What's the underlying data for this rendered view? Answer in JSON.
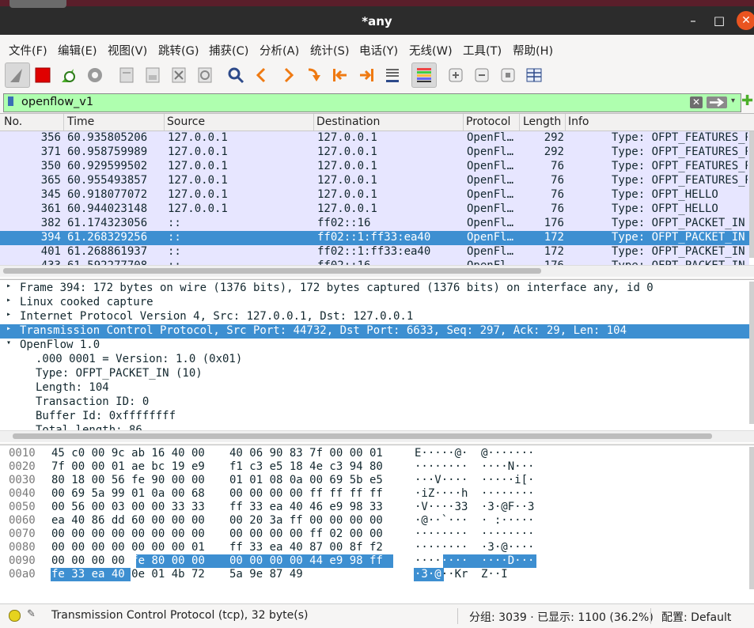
{
  "window": {
    "title": "*any",
    "minimize_label": "–",
    "maximize_label": "□",
    "close_label": "✕"
  },
  "menu": [
    "文件(F)",
    "编辑(E)",
    "视图(V)",
    "跳转(G)",
    "捕获(C)",
    "分析(A)",
    "统计(S)",
    "电话(Y)",
    "无线(W)",
    "工具(T)",
    "帮助(H)"
  ],
  "toolbar": {
    "icons": [
      "shark-fin-start-icon",
      "stop-capture-icon",
      "restart-capture-icon",
      "capture-options-icon",
      "open-file-icon",
      "save-file-icon",
      "close-file-icon",
      "reload-file-icon",
      "find-packet-icon",
      "go-back-icon",
      "go-forward-icon",
      "go-to-packet-icon",
      "go-first-icon",
      "go-last-icon",
      "autoscroll-icon",
      "colorize-icon",
      "zoom-in-icon",
      "zoom-out-icon",
      "normal-size-icon",
      "resize-columns-icon"
    ]
  },
  "filter": {
    "value": "openflow_v1",
    "clear_label": "✕"
  },
  "packet_list": {
    "columns": [
      "No.",
      "Time",
      "Source",
      "Destination",
      "Protocol",
      "Length",
      "Info"
    ],
    "rows": [
      {
        "no": "356",
        "time": "60.935805206",
        "src": "127.0.0.1",
        "dst": "127.0.0.1",
        "proto": "OpenFl…",
        "len": "292",
        "info": "Type: OFPT_FEATURES_REPLY"
      },
      {
        "no": "371",
        "time": "60.958759989",
        "src": "127.0.0.1",
        "dst": "127.0.0.1",
        "proto": "OpenFl…",
        "len": "292",
        "info": "Type: OFPT_FEATURES_REPLY"
      },
      {
        "no": "350",
        "time": "60.929599502",
        "src": "127.0.0.1",
        "dst": "127.0.0.1",
        "proto": "OpenFl…",
        "len": "76",
        "info": "Type: OFPT_FEATURES_REQUEST"
      },
      {
        "no": "365",
        "time": "60.955493857",
        "src": "127.0.0.1",
        "dst": "127.0.0.1",
        "proto": "OpenFl…",
        "len": "76",
        "info": "Type: OFPT_FEATURES_REQUEST"
      },
      {
        "no": "345",
        "time": "60.918077072",
        "src": "127.0.0.1",
        "dst": "127.0.0.1",
        "proto": "OpenFl…",
        "len": "76",
        "info": "Type: OFPT_HELLO"
      },
      {
        "no": "361",
        "time": "60.944023148",
        "src": "127.0.0.1",
        "dst": "127.0.0.1",
        "proto": "OpenFl…",
        "len": "76",
        "info": "Type: OFPT_HELLO"
      },
      {
        "no": "382",
        "time": "61.174323056",
        "src": "::",
        "dst": "ff02::16",
        "proto": "OpenFl…",
        "len": "176",
        "info": "Type: OFPT_PACKET_IN"
      },
      {
        "no": "394",
        "time": "61.268329256",
        "src": "::",
        "dst": "ff02::1:ff33:ea40",
        "proto": "OpenFl…",
        "len": "172",
        "info": "Type: OFPT_PACKET_IN",
        "selected": true
      },
      {
        "no": "401",
        "time": "61.268861937",
        "src": "::",
        "dst": "ff02::1:ff33:ea40",
        "proto": "OpenFl…",
        "len": "172",
        "info": "Type: OFPT_PACKET_IN"
      },
      {
        "no": "433",
        "time": "61.592277708",
        "src": "::",
        "dst": "ff02::16",
        "proto": "OpenFl…",
        "len": "176",
        "info": "Type: OFPT_PACKET_IN"
      }
    ]
  },
  "details": [
    {
      "indent": 0,
      "arrow": "▸",
      "text": "Frame 394: 172 bytes on wire (1376 bits), 172 bytes captured (1376 bits) on interface any, id 0"
    },
    {
      "indent": 0,
      "arrow": "▸",
      "text": "Linux cooked capture"
    },
    {
      "indent": 0,
      "arrow": "▸",
      "text": "Internet Protocol Version 4, Src: 127.0.0.1, Dst: 127.0.0.1"
    },
    {
      "indent": 0,
      "arrow": "▸",
      "text": "Transmission Control Protocol, Src Port: 44732, Dst Port: 6633, Seq: 297, Ack: 29, Len: 104",
      "selected": true
    },
    {
      "indent": 0,
      "arrow": "▾",
      "text": "OpenFlow 1.0"
    },
    {
      "indent": 1,
      "arrow": "",
      "text": ".000 0001 = Version: 1.0 (0x01)"
    },
    {
      "indent": 1,
      "arrow": "",
      "text": "Type: OFPT_PACKET_IN (10)"
    },
    {
      "indent": 1,
      "arrow": "",
      "text": "Length: 104"
    },
    {
      "indent": 1,
      "arrow": "",
      "text": "Transaction ID: 0"
    },
    {
      "indent": 1,
      "arrow": "",
      "text": "Buffer Id: 0xffffffff"
    },
    {
      "indent": 1,
      "arrow": "",
      "text": "Total length: 86"
    }
  ],
  "hex": [
    {
      "off": "0010",
      "b1": "45 c0 00 9c ab 16 40 00",
      "b2": "40 06 90 83 7f 00 00 01",
      "a1": "E·····@·",
      "a2": "@·······"
    },
    {
      "off": "0020",
      "b1": "7f 00 00 01 ae bc 19 e9",
      "b2": "f1 c3 e5 18 4e c3 94 80",
      "a1": "········",
      "a2": "····N···"
    },
    {
      "off": "0030",
      "b1": "80 18 00 56 fe 90 00 00",
      "b2": "01 01 08 0a 00 69 5b e5",
      "a1": "···V····",
      "a2": "·····i[·"
    },
    {
      "off": "0040",
      "b1": "00 69 5a 99 01 0a 00 68",
      "b2": "00 00 00 00 ff ff ff ff",
      "a1": "·iZ····h",
      "a2": "········"
    },
    {
      "off": "0050",
      "b1": "00 56 00 03 00 00 33 33",
      "b2": "ff 33 ea 40 46 e9 98 33",
      "a1": "·V····33",
      "a2": "·3·@F··3"
    },
    {
      "off": "0060",
      "b1": "ea 40 86 dd 60 00 00 00",
      "b2": "00 20 3a ff 00 00 00 00",
      "a1": "·@··`···",
      "a2": "· :·····"
    },
    {
      "off": "0070",
      "b1": "00 00 00 00 00 00 00 00",
      "b2": "00 00 00 00 ff 02 00 00",
      "a1": "········",
      "a2": "········"
    },
    {
      "off": "0080",
      "b1": "00 00 00 00 00 00 00 01",
      "b2": "ff 33 ea 40 87 00 8f f2",
      "a1": "········",
      "a2": "·3·@····"
    },
    {
      "off": "0090",
      "b1": "00 00 00 00 fe 80 00 00",
      "b2": "00 00 00 00 44 e9 98 ff",
      "a1": "········",
      "a2": "····D···"
    },
    {
      "off": "00a0",
      "b1": "fe 33 ea 40 0e 01 4b 72",
      "b2": "5a 9e 87 49",
      "a1": "·3·@··Kr",
      "a2": "Z··I"
    }
  ],
  "status": {
    "left": "Transmission Control Protocol (tcp), 32 byte(s)",
    "packets": "分组: 3039 · 已显示: 1100 (36.2%)",
    "profile": "配置: Default"
  }
}
